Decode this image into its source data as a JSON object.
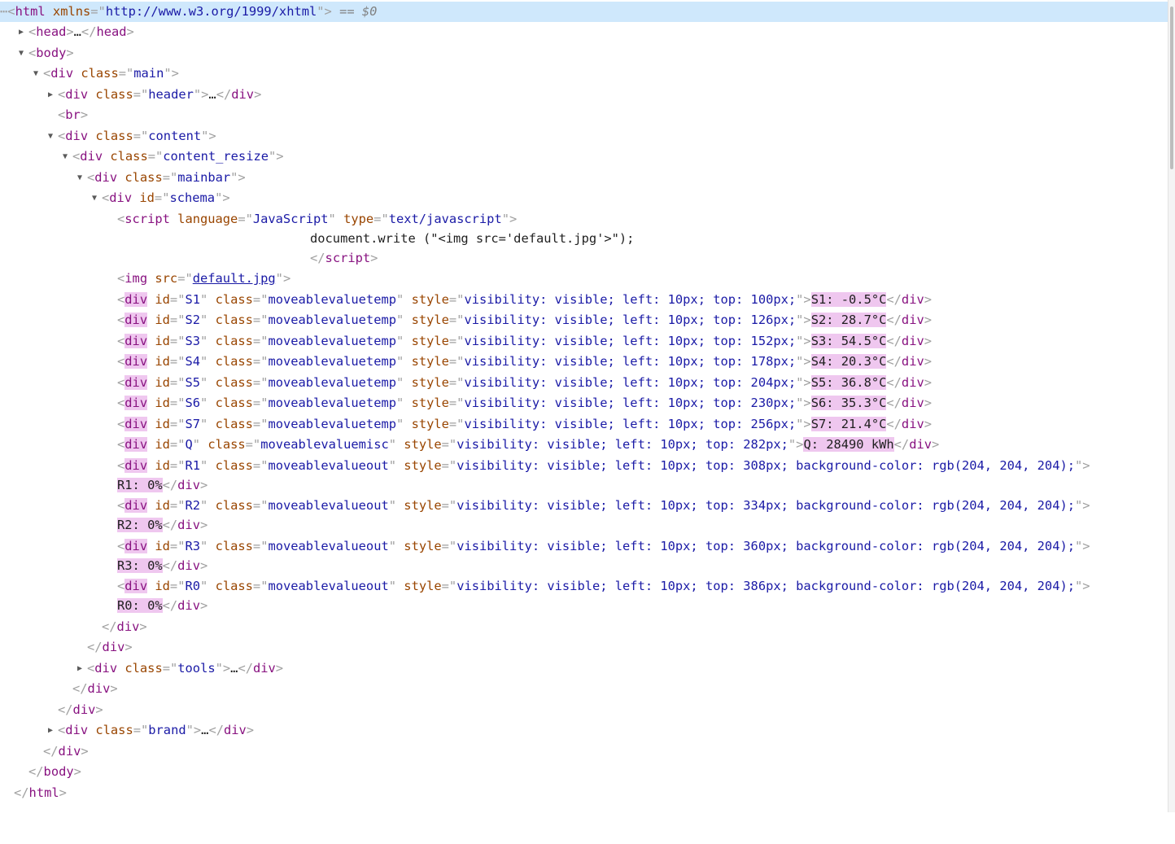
{
  "elements_panel": {
    "html_open": {
      "prefix": "⋯",
      "tag": "html",
      "attr": "xmlns",
      "value": "http://www.w3.org/1999/xhtml",
      "suffix": " == $0"
    },
    "head_collapsed": {
      "tag": "head",
      "ellipsis": "…"
    },
    "body_open": "body",
    "main_div": {
      "tag": "div",
      "attr": "class",
      "value": "main"
    },
    "header_div": {
      "tag": "div",
      "attr": "class",
      "value": "header",
      "ellipsis": "…"
    },
    "br": "br",
    "content_div": {
      "tag": "div",
      "attr": "class",
      "value": "content"
    },
    "content_resize_div": {
      "tag": "div",
      "attr": "class",
      "value": "content_resize"
    },
    "mainbar_div": {
      "tag": "div",
      "attr": "class",
      "value": "mainbar"
    },
    "schema_div": {
      "tag": "div",
      "attr": "id",
      "value": "schema"
    },
    "script_tag": {
      "tag": "script",
      "attr1": "language",
      "value1": "JavaScript",
      "attr2": "type",
      "value2": "text/javascript"
    },
    "script_body": "document.write (\"<img src='default.jpg'>\");",
    "script_close": "script",
    "img_tag": {
      "tag": "img",
      "attr": "src",
      "value": "default.jpg"
    },
    "sensor_divs": [
      {
        "id": "S1",
        "class": "moveablevaluetemp",
        "style": "visibility: visible; left: 10px; top: 100px;",
        "text": "S1: -0.5°C"
      },
      {
        "id": "S2",
        "class": "moveablevaluetemp",
        "style": "visibility: visible; left: 10px; top: 126px;",
        "text": "S2: 28.7°C"
      },
      {
        "id": "S3",
        "class": "moveablevaluetemp",
        "style": "visibility: visible; left: 10px; top: 152px;",
        "text": "S3: 54.5°C"
      },
      {
        "id": "S4",
        "class": "moveablevaluetemp",
        "style": "visibility: visible; left: 10px; top: 178px;",
        "text": "S4: 20.3°C"
      },
      {
        "id": "S5",
        "class": "moveablevaluetemp",
        "style": "visibility: visible; left: 10px; top: 204px;",
        "text": "S5: 36.8°C"
      },
      {
        "id": "S6",
        "class": "moveablevaluetemp",
        "style": "visibility: visible; left: 10px; top: 230px;",
        "text": "S6: 35.3°C"
      },
      {
        "id": "S7",
        "class": "moveablevaluetemp",
        "style": "visibility: visible; left: 10px; top: 256px;",
        "text": "S7: 21.4°C"
      }
    ],
    "q_div": {
      "id": "Q",
      "class": "moveablevaluemisc",
      "style": "visibility: visible; left: 10px; top: 282px;",
      "text": "Q: 28490 kWh"
    },
    "relay_divs": [
      {
        "id": "R1",
        "class": "moveablevalueout",
        "style": "visibility: visible; left: 10px; top: 308px; background-color: rgb(204, 204, 204);",
        "text": "R1: 0%"
      },
      {
        "id": "R2",
        "class": "moveablevalueout",
        "style": "visibility: visible; left: 10px; top: 334px; background-color: rgb(204, 204, 204);",
        "text": "R2: 0%"
      },
      {
        "id": "R3",
        "class": "moveablevalueout",
        "style": "visibility: visible; left: 10px; top: 360px; background-color: rgb(204, 204, 204);",
        "text": "R3: 0%"
      },
      {
        "id": "R0",
        "class": "moveablevalueout",
        "style": "visibility: visible; left: 10px; top: 386px; background-color: rgb(204, 204, 204);",
        "text": "R0: 0%"
      }
    ],
    "div_tag": "div",
    "tools_div": {
      "tag": "div",
      "attr": "class",
      "value": "tools",
      "ellipsis": "…"
    },
    "brand_div": {
      "tag": "div",
      "attr": "class",
      "value": "brand",
      "ellipsis": "…"
    },
    "body_close": "body",
    "html_close": "html"
  },
  "colors": {
    "tag": "#881280",
    "attribute_name": "#994500",
    "attribute_value": "#1a1aa6",
    "punctuation": "#a0a0a0",
    "selection": "#cfe8fc",
    "search_highlight": "#efc7ef"
  },
  "icons": {
    "expanded": "triangle-down-icon",
    "collapsed": "triangle-right-icon"
  }
}
